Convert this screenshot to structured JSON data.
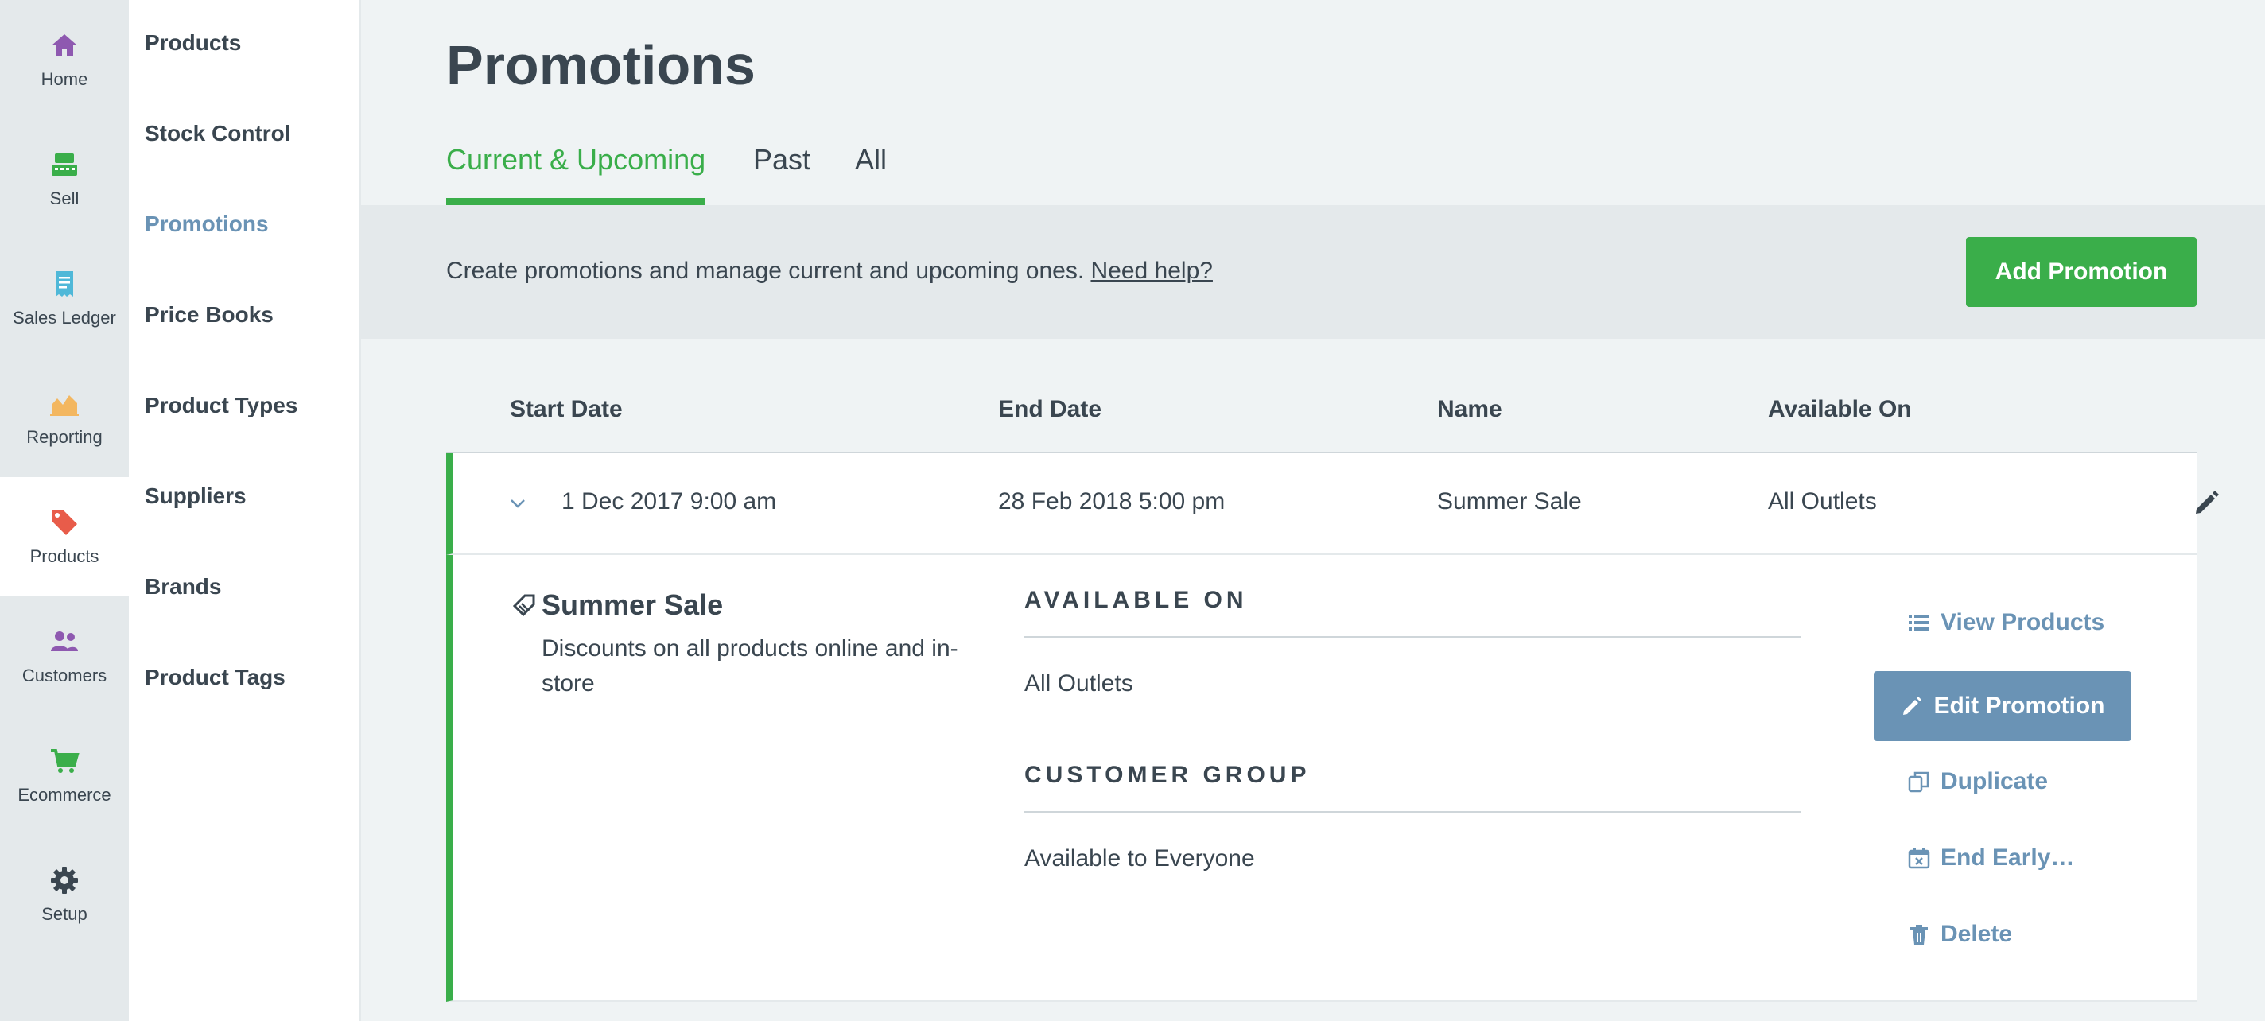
{
  "rail": {
    "items": [
      {
        "label": "Home",
        "icon": "home-icon",
        "color": "#8e59b0"
      },
      {
        "label": "Sell",
        "icon": "register-icon",
        "color": "#3aae4a"
      },
      {
        "label": "Sales Ledger",
        "icon": "receipt-icon",
        "color": "#4fb8d8"
      },
      {
        "label": "Reporting",
        "icon": "chart-icon",
        "color": "#f3b760"
      },
      {
        "label": "Products",
        "icon": "tag-icon",
        "color": "#e85c4a"
      },
      {
        "label": "Customers",
        "icon": "users-icon",
        "color": "#8e59b0"
      },
      {
        "label": "Ecommerce",
        "icon": "cart-icon",
        "color": "#3aae4a"
      },
      {
        "label": "Setup",
        "icon": "gear-icon",
        "color": "#3a4650"
      }
    ],
    "active": "Products"
  },
  "subnav": {
    "items": [
      "Products",
      "Stock Control",
      "Promotions",
      "Price Books",
      "Product Types",
      "Suppliers",
      "Brands",
      "Product Tags"
    ],
    "active": "Promotions"
  },
  "page": {
    "title": "Promotions",
    "tabs": [
      "Current & Upcoming",
      "Past",
      "All"
    ],
    "active_tab": "Current & Upcoming"
  },
  "banner": {
    "text": "Create promotions and manage current and upcoming ones. ",
    "help_link": "Need help?",
    "add_button": "Add Promotion"
  },
  "table": {
    "headers": [
      "Start Date",
      "End Date",
      "Name",
      "Available On"
    ],
    "rows": [
      {
        "start": "1 Dec 2017 9:00 am",
        "end": "28 Feb 2018 5:00 pm",
        "name": "Summer Sale",
        "available_on": "All Outlets"
      }
    ]
  },
  "detail": {
    "name": "Summer Sale",
    "description": "Discounts on all products online and in-store",
    "available_on_heading": "AVAILABLE ON",
    "available_on_value": "All Outlets",
    "customer_group_heading": "CUSTOMER GROUP",
    "customer_group_value": "Available to Everyone",
    "actions": {
      "view_products": "View Products",
      "edit_promotion": "Edit Promotion",
      "duplicate": "Duplicate",
      "end_early": "End Early…",
      "delete": "Delete"
    }
  },
  "colors": {
    "accent_green": "#3aae4a",
    "link_blue": "#6a93b5",
    "text": "#3a4650"
  }
}
